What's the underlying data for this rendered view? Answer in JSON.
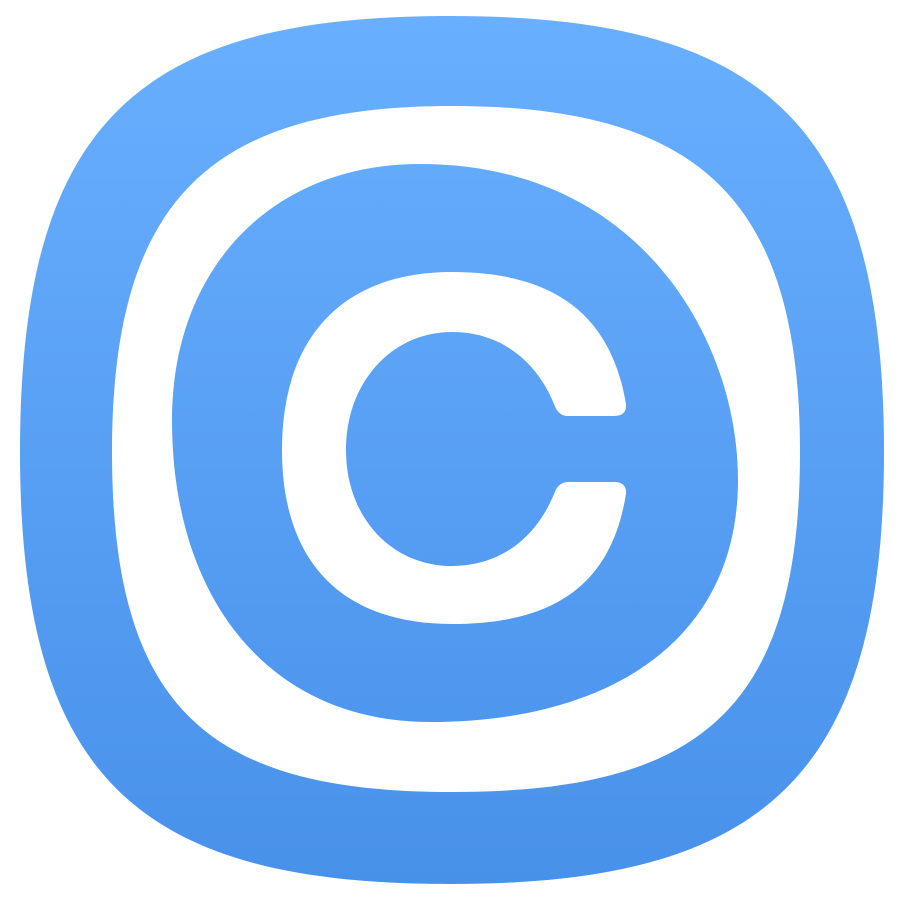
{
  "icon": {
    "name": "copyright-icon",
    "colors": {
      "gradient_top": "#69AFFF",
      "gradient_bottom": "#4891EA",
      "symbol": "#FFFFFF",
      "background": "#FFFFFF"
    }
  }
}
